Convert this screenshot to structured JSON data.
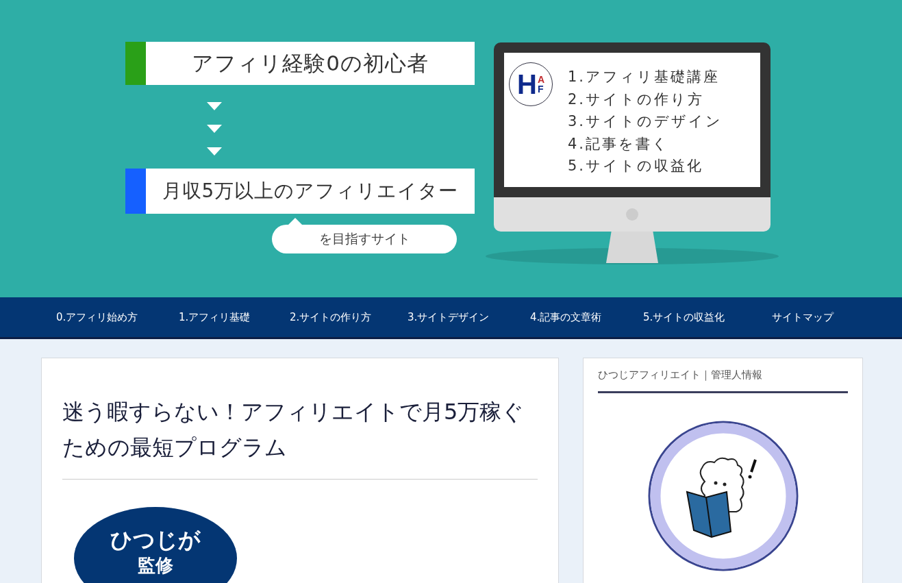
{
  "banner": {
    "start_label": "アフィリ経験0の初心者",
    "goal_label": "月収5万以上のアフィリエイター",
    "goal_suffix": "を目指すサイト",
    "logo": {
      "letters": [
        "H",
        "A",
        "F"
      ]
    },
    "course_list": [
      "1.アフィリ基礎講座",
      "2.サイトの作り方",
      "3.サイトのデザイン",
      "4.記事を書く",
      "5.サイトの収益化"
    ]
  },
  "nav": {
    "items": [
      "0.アフィリ始め方",
      "1.アフィリ基礎",
      "2.サイトの作り方",
      "3.サイトデザイン",
      "4.記事の文章術",
      "5.サイトの収益化",
      "サイトマップ"
    ]
  },
  "article": {
    "title": "迷う暇すらない！アフィリエイトで月5万稼ぐための最短プログラム",
    "badge_lines": [
      "ひつじが",
      "監修"
    ]
  },
  "sidebar": {
    "widget_title": "ひつじアフィリエイト｜管理人情報"
  }
}
